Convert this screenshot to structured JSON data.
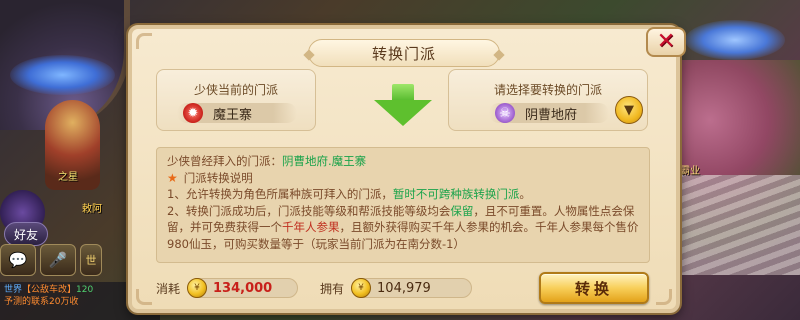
{
  "background": {
    "name_labels": [
      "之星",
      "明珠霸业",
      "敕阿"
    ],
    "friend_button": "好友",
    "chat_icons": [
      "对话",
      "语音",
      "世"
    ],
    "chat_lines": [
      {
        "channel": "世界",
        "speaker": "【公敌车改】",
        "text": "120"
      },
      {
        "text": "予测的联系20万收"
      }
    ]
  },
  "dialog": {
    "title": "转换门派",
    "close_symbol": "✕",
    "current": {
      "heading": "少侠当前的门派",
      "sect_name": "魔王寨",
      "icon": "demon-crest-icon"
    },
    "select": {
      "heading": "请选择要转换的门派",
      "sect_name": "阴曹地府",
      "icon": "ghost-crest-icon",
      "dropdown_symbol": "▼"
    },
    "joined": {
      "label": "少侠曾经拜入的门派：",
      "value": "阴曹地府.魔王寨"
    },
    "rules": {
      "star": "★",
      "title": "门派转换说明",
      "line1_prefix": "1、允许转换为角色所属种族可拜入的门派，",
      "line1_highlight": "暂时不可跨种族转换门派",
      "line1_suffix": "。",
      "line2_prefix": "2、转换门派成功后，门派技能等级和帮派技能等级均会",
      "line2_highlight": "保留",
      "line2_suffix": "，且不可重置。人物属性点会保留，并可免费获得一个",
      "line2_highlight2": "千年人参果",
      "line2_suffix2": "，且额外获得购买千年人参果的机会。千年人参果每个售价980仙玉，可购买数量等于（玩家当前门派为在南分数-1）"
    },
    "cost": {
      "label": "消耗",
      "value": "134,000"
    },
    "owned": {
      "label": "拥有",
      "value": "104,979"
    },
    "convert_button": "转换"
  }
}
